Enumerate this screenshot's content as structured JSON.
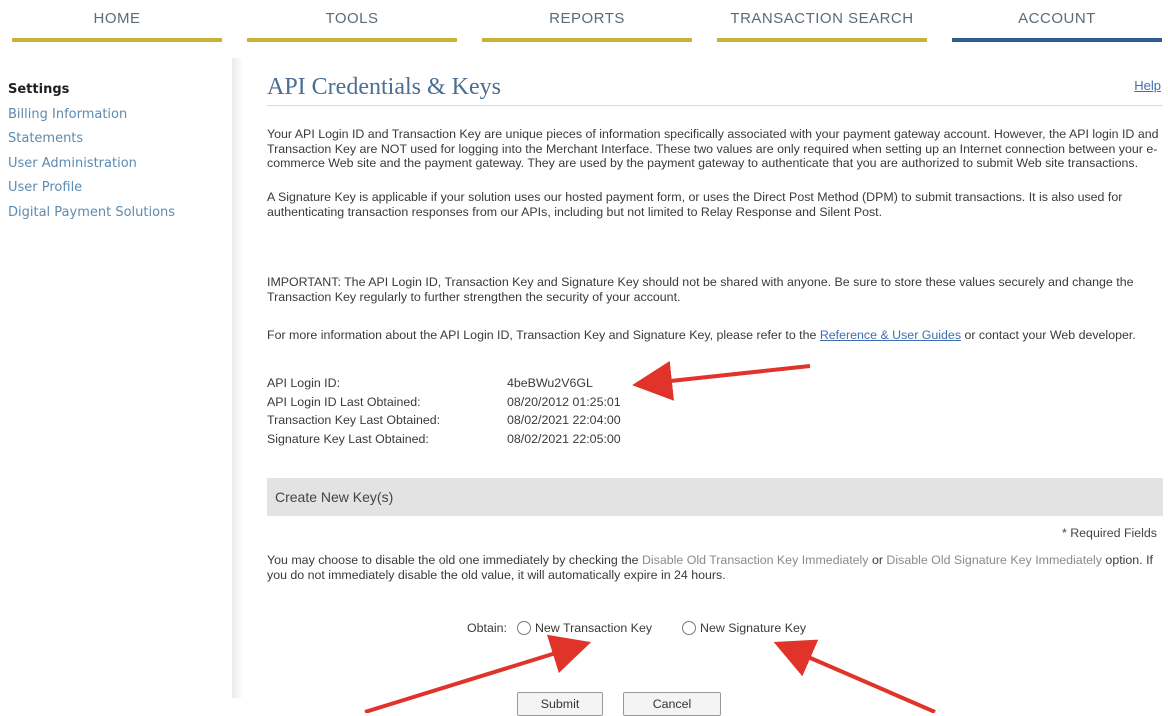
{
  "nav": {
    "tabs": [
      "HOME",
      "TOOLS",
      "REPORTS",
      "TRANSACTION SEARCH",
      "ACCOUNT"
    ],
    "active": "ACCOUNT"
  },
  "sidebar": {
    "items": [
      "Settings",
      "Billing Information",
      "Statements",
      "User Administration",
      "User Profile",
      "Digital Payment Solutions"
    ],
    "current": "Settings"
  },
  "page": {
    "title": "API Credentials & Keys",
    "help": "Help",
    "para1": "Your API Login ID and Transaction Key are unique pieces of information specifically associated with your payment gateway account. However, the API login ID and Transaction Key are NOT used for logging into the Merchant Interface. These two values are only required when setting up an Internet connection between your e-commerce Web site and the payment gateway. They are used by the payment gateway to authenticate that you are authorized to submit Web site transactions.",
    "para2": "A Signature Key is applicable if your solution uses our hosted payment form, or uses the Direct Post Method (DPM) to submit transactions. It is also used for authenticating transaction responses from our APIs, including but not limited to Relay Response and Silent Post.",
    "para3": "IMPORTANT: The API Login ID, Transaction Key and Signature Key should not be shared with anyone. Be sure to store these values securely and change the Transaction Key regularly to further strengthen the security of your account.",
    "para4_before": "For more information about the API Login ID, Transaction Key and Signature Key, please refer to the ",
    "para4_link": "Reference & User Guides",
    "para4_after": " or contact your Web developer."
  },
  "credentials": [
    {
      "label": "API Login ID:",
      "value": "4beBWu2V6GL"
    },
    {
      "label": "API Login ID Last Obtained:",
      "value": "08/20/2012 01:25:01"
    },
    {
      "label": "Transaction Key Last Obtained:",
      "value": "08/02/2021 22:04:00"
    },
    {
      "label": "Signature Key Last Obtained:",
      "value": "08/02/2021 22:05:00"
    }
  ],
  "create": {
    "header": "Create New Key(s)",
    "required": "* Required Fields",
    "note_1": "You may choose to disable the old one immediately by checking the ",
    "note_2": "Disable Old Transaction Key Immediately",
    "note_3": " or ",
    "note_4": "Disable Old Signature Key Immediately",
    "note_5": " option. If you do not immediately disable the old value, it will automatically expire in 24 hours.",
    "obtain_label": "Obtain:",
    "option_transaction": "New Transaction Key",
    "option_signature": "New Signature Key",
    "submit": "Submit",
    "cancel": "Cancel"
  },
  "annotation_color": "#e0332a"
}
